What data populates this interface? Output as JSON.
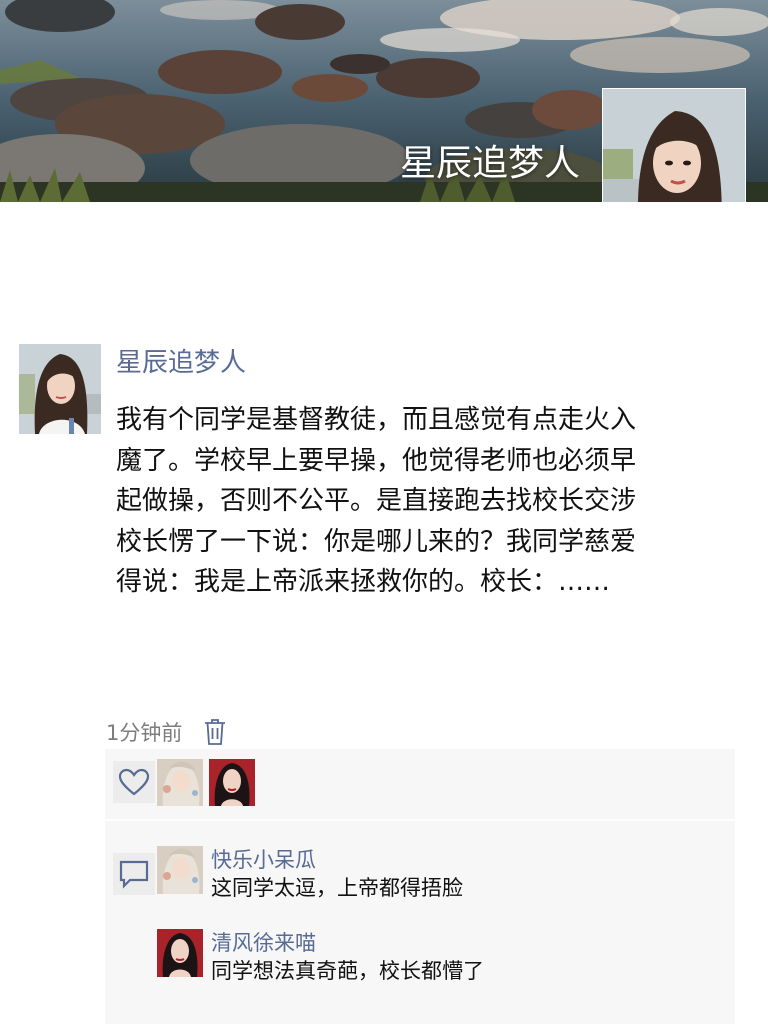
{
  "profile": {
    "cover_name": "星辰追梦人"
  },
  "post": {
    "author": "星辰追梦人",
    "lines": [
      "我有个同学是基督教徒，而且感觉有点走火入",
      "魔了。学校早上要早操，他觉得老师也必须早",
      "起做操，否则不公平。是直接跑去找校长交涉",
      "校长愣了一下说：你是哪儿来的？我同学慈爱",
      "得说：我是上帝派来拯救你的。校长：……"
    ],
    "time": "1分钟前"
  },
  "likes": {
    "icon": "heart-outline-icon"
  },
  "comments": [
    {
      "user": "快乐小呆瓜",
      "text": "这同学太逗，上帝都得捂脸"
    },
    {
      "user": "清风徐来喵",
      "text": "同学想法真奇葩，校长都懵了"
    }
  ],
  "colors": {
    "link": "#576b95",
    "panel": "#f7f7f7",
    "time": "#7d7d7d"
  }
}
